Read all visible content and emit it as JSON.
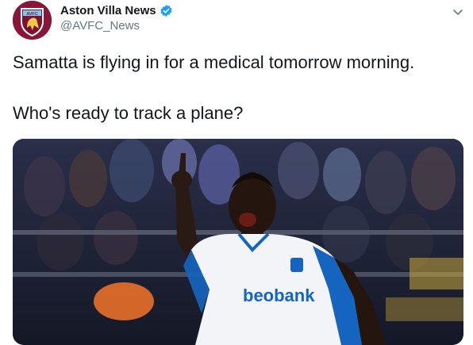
{
  "account": {
    "display_name": "Aston Villa News",
    "handle": "@AVFC_News",
    "avatar_text": "AVFC",
    "verified": true
  },
  "tweet": {
    "text": "Samatta is flying in for a medical tomorrow morning.\n\nWho's ready to track a plane?"
  },
  "media": {
    "shirt_sponsor": "beobank"
  },
  "colors": {
    "verified": "#1da1f2",
    "avatar_bg": "#8b1538",
    "kit_blue": "#1565c0"
  },
  "icons": [
    "verified-badge-icon",
    "chevron-down-icon"
  ]
}
